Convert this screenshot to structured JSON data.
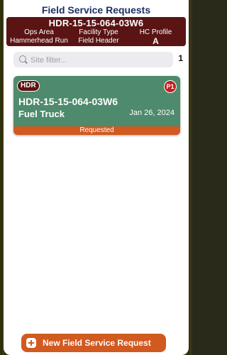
{
  "nav": {
    "title": "Field Service Requests"
  },
  "header_card": {
    "id": "HDR-15-15-064-03W6",
    "labels": [
      "Ops Area",
      "Facility Type",
      "HC Profile"
    ],
    "values": [
      "Hammerhead Run",
      "Field Header",
      "A"
    ]
  },
  "search": {
    "placeholder": "Site filter...",
    "value": ""
  },
  "results_count": "1",
  "requests": [
    {
      "badge": "HDR",
      "priority": "P1",
      "id": "HDR-15-15-064-03W6",
      "vehicle": "Fuel Truck",
      "date": "Jan 26, 2024",
      "status": "Requested"
    }
  ],
  "new_button": {
    "label": "New Field Service Request",
    "icon": "plus-icon"
  },
  "colors": {
    "header_bg": "#5a1414",
    "card_bg": "#4e8a6c",
    "accent_orange": "#d2591f",
    "priority_red": "#c21f1f",
    "title_navy": "#1f2f66"
  }
}
